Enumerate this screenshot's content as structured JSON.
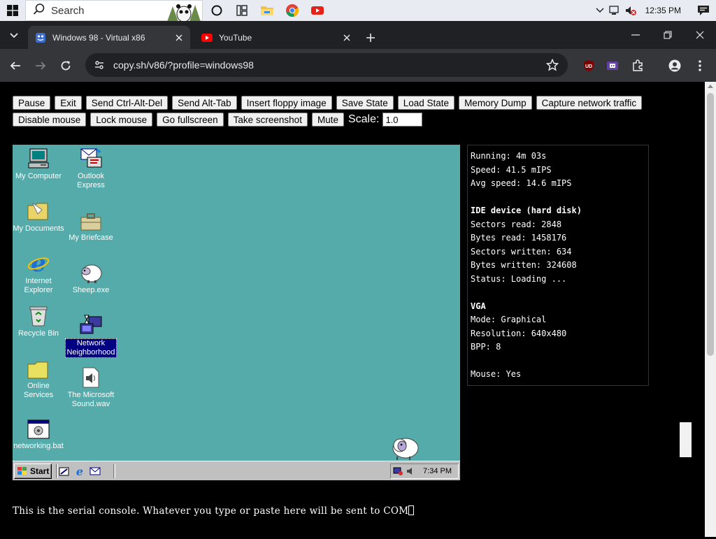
{
  "windows_taskbar": {
    "search_label": "Search",
    "clock": "12:35 PM"
  },
  "chrome": {
    "tabs": [
      {
        "title": "Windows 98 - Virtual x86"
      },
      {
        "title": "YouTube"
      }
    ],
    "url": "copy.sh/v86/?profile=windows98",
    "ext_badge": "UD"
  },
  "controls": {
    "row1": [
      "Pause",
      "Exit",
      "Send Ctrl-Alt-Del",
      "Send Alt-Tab",
      "Insert floppy image",
      "Save State",
      "Load State",
      "Memory Dump",
      "Capture network traffic"
    ],
    "row2": [
      "Disable mouse",
      "Lock mouse",
      "Go fullscreen",
      "Take screenshot",
      "Mute"
    ],
    "scale_label": "Scale:",
    "scale_value": "1.0"
  },
  "desktop": {
    "icons": [
      {
        "label": "My Computer"
      },
      {
        "label": "Outlook Express"
      },
      {
        "label": "My Documents"
      },
      {
        "label": "My Briefcase"
      },
      {
        "label": "Internet Explorer"
      },
      {
        "label": "Sheep.exe"
      },
      {
        "label": "Recycle Bin"
      },
      {
        "label": "Network Neighborhood"
      },
      {
        "label": "Online Services"
      },
      {
        "label": "The Microsoft Sound.wav"
      },
      {
        "label": "networking.bat"
      }
    ],
    "start_label": "Start",
    "clock": "7:34 PM"
  },
  "stats": {
    "running": "Running: 4m 03s",
    "speed": "Speed: 41.5 mIPS",
    "avg_speed": "Avg speed: 14.6 mIPS",
    "ide_header": "IDE device (hard disk)",
    "sectors_read": "Sectors read: 2848",
    "bytes_read": "Bytes read: 1458176",
    "sectors_written": "Sectors written: 634",
    "bytes_written": "Bytes written: 324608",
    "status": "Status: Loading ...",
    "vga_header": "VGA",
    "mode": "Mode: Graphical",
    "resolution": "Resolution: 640x480",
    "bpp": "BPP: 8",
    "mouse": "Mouse: Yes"
  },
  "serial": {
    "text": "This is the serial console. Whatever you type or paste here will be sent to COM"
  }
}
